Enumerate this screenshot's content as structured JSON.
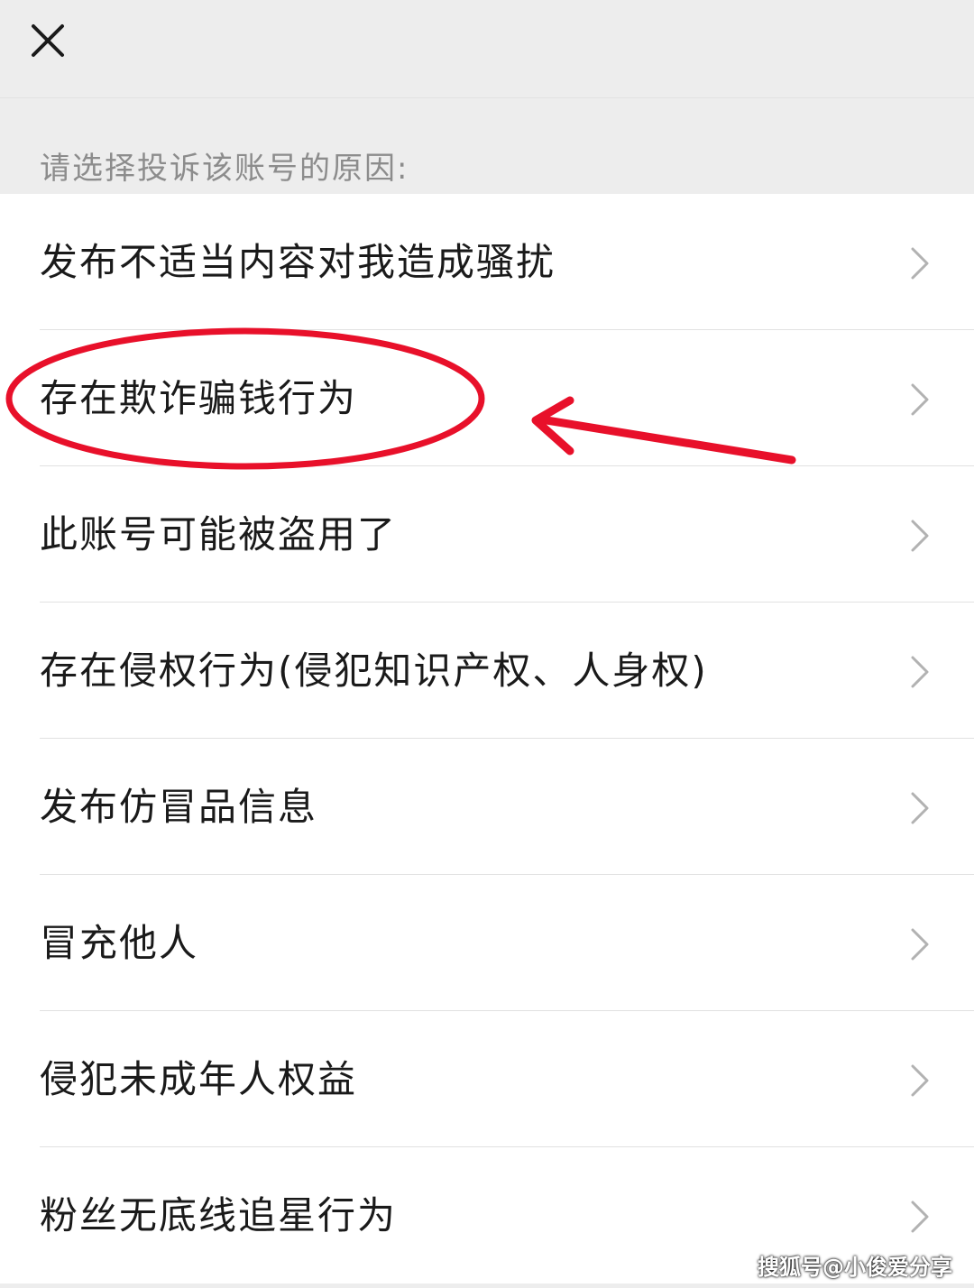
{
  "header": {
    "close_icon": "close-icon"
  },
  "section": {
    "title": "请选择投诉该账号的原因:"
  },
  "reasons": [
    {
      "label": "发布不适当内容对我造成骚扰",
      "icon": "chevron-right-icon"
    },
    {
      "label": "存在欺诈骗钱行为",
      "icon": "chevron-right-icon",
      "highlighted": true
    },
    {
      "label": "此账号可能被盗用了",
      "icon": "chevron-right-icon"
    },
    {
      "label": "存在侵权行为(侵犯知识产权、人身权)",
      "icon": "chevron-right-icon"
    },
    {
      "label": "发布仿冒品信息",
      "icon": "chevron-right-icon"
    },
    {
      "label": "冒充他人",
      "icon": "chevron-right-icon"
    },
    {
      "label": "侵犯未成年人权益",
      "icon": "chevron-right-icon"
    },
    {
      "label": "粉丝无底线追星行为",
      "icon": "chevron-right-icon"
    }
  ],
  "annotation": {
    "color": "#e8102a",
    "shapes": [
      "ellipse",
      "arrow"
    ]
  },
  "watermark": {
    "text": "搜狐号@小俊爱分享"
  },
  "colors": {
    "background": "#ededed",
    "list_background": "#ffffff",
    "text": "#1a1a1a",
    "muted_text": "#8c8c8c",
    "chevron": "#b2b2b2"
  }
}
